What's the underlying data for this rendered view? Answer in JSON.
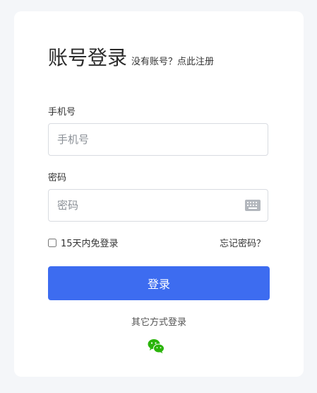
{
  "login": {
    "title": "账号登录",
    "signup_prompt": "没有账号？点此注册",
    "phone_label": "手机号",
    "phone_placeholder": "手机号",
    "password_label": "密码",
    "password_placeholder": "密码",
    "remember_label": "15天内免登录",
    "forgot_label": "忘记密码？",
    "submit_label": "登录",
    "other_methods_label": "其它方式登录"
  },
  "colors": {
    "background": "#f4f6f9",
    "card": "#ffffff",
    "primary": "#3d6cf0",
    "wechat": "#2ab40a"
  },
  "icons": {
    "keyboard": "keyboard-icon",
    "wechat": "wechat-icon"
  }
}
